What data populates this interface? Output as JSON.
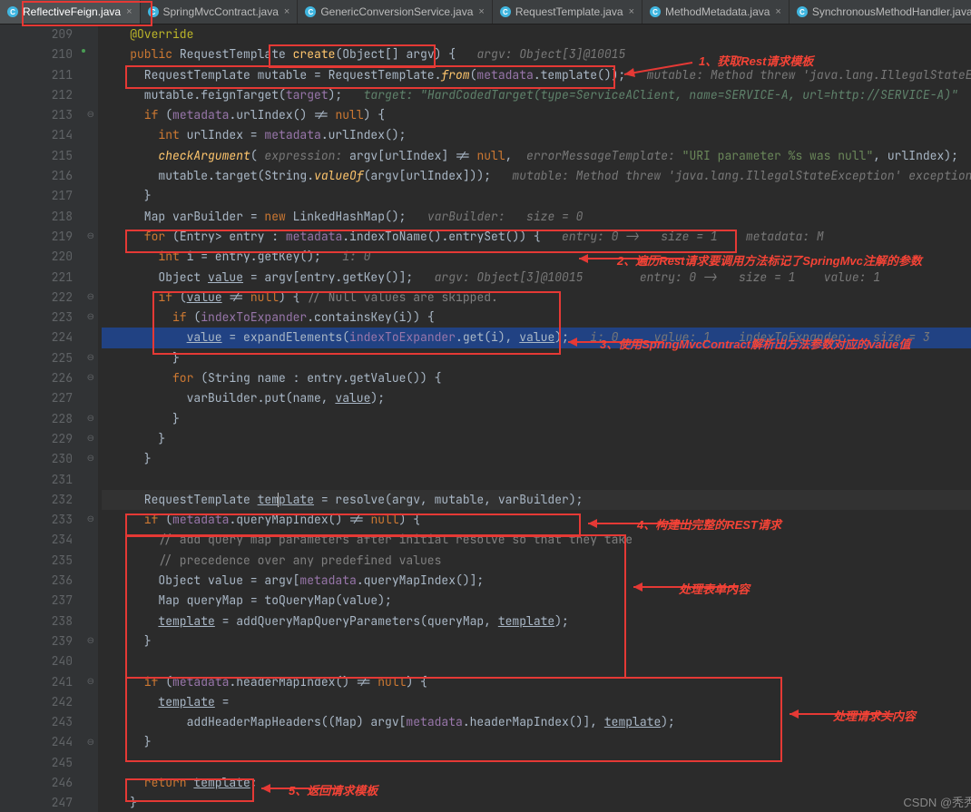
{
  "tabs": [
    {
      "name": "ReflectiveFeign.java",
      "active": true
    },
    {
      "name": "SpringMvcContract.java",
      "active": false
    },
    {
      "name": "GenericConversionService.java",
      "active": false
    },
    {
      "name": "RequestTemplate.java",
      "active": false
    },
    {
      "name": "MethodMetadata.java",
      "active": false
    },
    {
      "name": "SynchronousMethodHandler.java",
      "active": false
    }
  ],
  "lineStart": 209,
  "lineEnd": 247,
  "currentLine": 232,
  "annotations": {
    "a1": "1、获取Rest请求模板",
    "a2": "2、遍历Rest请求要调用方法标记了SpringMvc注解的参数",
    "a3": "3、使用SpringMvcContract解析出方法参数对应的value值",
    "a4": "4、构建出完整的REST请求",
    "a5": "处理表单内容",
    "a6": "处理请求头内容",
    "a7": "5、返回请求模板"
  },
  "watermark": "CSDN @秃秃爱健身",
  "code": {
    "l209": "@Override",
    "l210_pre": "public ",
    "l210_ty": "RequestTemplate ",
    "l210_fn": "create",
    "l210_post": "(Object[] argv) {",
    "l210_hint": "   argv: Object[3]@10015",
    "l211_a": "  RequestTemplate mutable = RequestTemplate.",
    "l211_b": "from",
    "l211_c": "(",
    "l211_d": "metadata",
    "l211_e": ".template());",
    "l211_hint": "   mutable: Method threw 'java.lang.IllegalStateExcepti",
    "l212_a": "  mutable.feignTarget(",
    "l212_b": "target",
    "l212_c": ");",
    "l212_hint": "   target: \"HardCodedTarget(type=ServiceAClient, name=SERVICE-A, url=http://SERVICE-A)\"",
    "l213_a": "  if ",
    "l213_b": "(",
    "l213_c": "metadata",
    "l213_d": ".urlIndex() != ",
    "l213_e": "null",
    "l213_f": ") {",
    "l214_a": "    int ",
    "l214_b": "urlIndex = ",
    "l214_c": "metadata",
    "l214_d": ".urlIndex();",
    "l215_a": "    ",
    "l215_b": "checkArgument",
    "l215_c": "(",
    "l215_h1": " expression: ",
    "l215_d": "argv[urlIndex] != ",
    "l215_e": "null",
    "l215_f": ",",
    "l215_h2": "  errorMessageTemplate: ",
    "l215_g": "\"URI parameter %s was null\"",
    "l215_h": ", urlIndex);",
    "l216_a": "    mutable.target(String.",
    "l216_b": "valueOf",
    "l216_c": "(argv[urlIndex]));",
    "l216_hint": "   mutable: Method threw 'java.lang.IllegalStateException' exception.  Cann",
    "l217": "  }",
    "l218_a": "  Map<String, Object> varBuilder = ",
    "l218_b": "new ",
    "l218_c": "LinkedHashMap<String, Object>();",
    "l218_hint": "   varBuilder:   size = 0",
    "l219_a": "  for ",
    "l219_b": "(Entry<Integer, Collection<String>> entry : ",
    "l219_c": "metadata",
    "l219_d": ".indexToName().entrySet()) {",
    "l219_hint": "   entry: 0 ->   size = 1    metadata: M",
    "l220_a": "    int ",
    "l220_b": "i = entry.getKey();",
    "l220_hint": "   i: 0",
    "l221_a": "    Object ",
    "l221_b": "value",
    "l221_c": " = argv[entry.getKey()];",
    "l221_hint": "   argv: Object[3]@10015        entry: 0 ->   size = 1    value: 1",
    "l222_a": "    if ",
    "l222_b": "(",
    "l222_c": "value",
    "l222_d": " != ",
    "l222_e": "null",
    "l222_f": ") { ",
    "l222_g": "// Null values are skipped.",
    "l223_a": "      if ",
    "l223_b": "(",
    "l223_c": "indexToExpander",
    "l223_d": ".containsKey(i)) {",
    "l224_a": "        ",
    "l224_b": "value",
    "l224_c": " = expandElements(",
    "l224_d": "indexToExpander",
    "l224_e": ".get(i), ",
    "l224_f": "value",
    "l224_g": ");",
    "l224_hint": "   i: 0     value: 1    indexToExpander:   size = 3",
    "l225": "      }",
    "l226_a": "      for ",
    "l226_b": "(String name : entry.getValue()) {",
    "l227_a": "        varBuilder.put(name, ",
    "l227_b": "value",
    "l227_c": ");",
    "l228": "      }",
    "l229": "    }",
    "l230": "  }",
    "l231": "",
    "l232_a": "  RequestTemplate ",
    "l232_b": "tem",
    "l232_c": "plate",
    "l232_d": " = resolve(argv, mutable, varBuilder);",
    "l233_a": "  if ",
    "l233_b": "(",
    "l233_c": "metadata",
    "l233_d": ".queryMapIndex() != ",
    "l233_e": "null",
    "l233_f": ") {",
    "l234": "    // add query map parameters after initial resolve so that they take",
    "l235": "    // precedence over any predefined values",
    "l236_a": "    Object value = argv[",
    "l236_b": "metadata",
    "l236_c": ".queryMapIndex()];",
    "l237": "    Map<String, Object> queryMap = toQueryMap(value);",
    "l238_a": "    ",
    "l238_b": "template",
    "l238_c": " = addQueryMapQueryParameters(queryMap, ",
    "l238_d": "template",
    "l238_e": ");",
    "l239": "  }",
    "l240": "",
    "l241_a": "  if ",
    "l241_b": "(",
    "l241_c": "metadata",
    "l241_d": ".headerMapIndex() != ",
    "l241_e": "null",
    "l241_f": ") {",
    "l242_a": "    ",
    "l242_b": "template",
    "l242_c": " =",
    "l243_a": "        addHeaderMapHeaders((Map<String, Object>) argv[",
    "l243_b": "metadata",
    "l243_c": ".headerMapIndex()], ",
    "l243_d": "template",
    "l243_e": ");",
    "l244": "  }",
    "l245": "",
    "l246_a": "  return ",
    "l246_b": "template",
    "l246_c": ";",
    "l247": "}"
  }
}
